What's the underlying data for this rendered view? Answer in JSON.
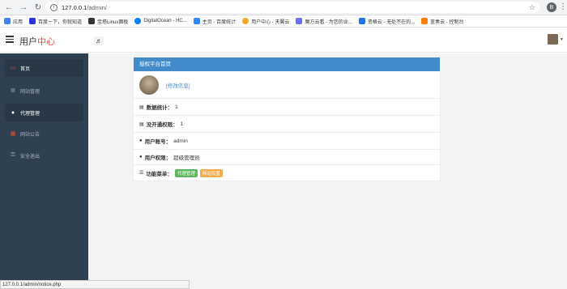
{
  "browser": {
    "url_host": "127.0.0.1",
    "url_path": "/admin/",
    "ext_label": "B",
    "bookmarks": [
      {
        "label": "应用",
        "color": "#4285f4"
      },
      {
        "label": "百度一下，你就知道",
        "color": "#2932e1"
      },
      {
        "label": "宝塔Linux面板",
        "color": "#333333"
      },
      {
        "label": "DigitalOcean - HC...",
        "color": "#0080ff"
      },
      {
        "label": "主页 - 百度统计",
        "color": "#3388ff"
      },
      {
        "label": "用户中心 - 天翼云",
        "color": "#f5a623"
      },
      {
        "label": "魔方云看 - 为您的业...",
        "color": "#6c6cff"
      },
      {
        "label": "资格云 - 无处不在的...",
        "color": "#1a73e8"
      },
      {
        "label": "蓝奏云 - 控制台",
        "color": "#ff7a00"
      }
    ]
  },
  "header": {
    "brand_main": "用户",
    "brand_accent": "中心",
    "music_icon": "♬"
  },
  "sidebar": {
    "items": [
      {
        "label": "首页",
        "icon": "💻",
        "active": true
      },
      {
        "label": "网站管理",
        "icon": "⚙",
        "active": false
      },
      {
        "label": "代理管理",
        "icon": "👤",
        "active": true
      },
      {
        "label": "网站公告",
        "icon": "▦",
        "active": false
      },
      {
        "label": "安全退出",
        "icon": "🔑",
        "active": false
      }
    ]
  },
  "panel": {
    "title": "授权平台首页",
    "edit_link": "[修改信息]",
    "rows": [
      {
        "label": "数据统计：",
        "value": "1"
      },
      {
        "label": "没开通权限：",
        "value": "1"
      },
      {
        "label": "用户账号：",
        "value": "admin"
      },
      {
        "label": "用户权限：",
        "value": "超级管理员"
      }
    ],
    "menu_label": "功能菜单：",
    "menu_tags": [
      "代理管理",
      "网站设置"
    ]
  },
  "status_bar": "127.0.0.1/admin/notice.php"
}
